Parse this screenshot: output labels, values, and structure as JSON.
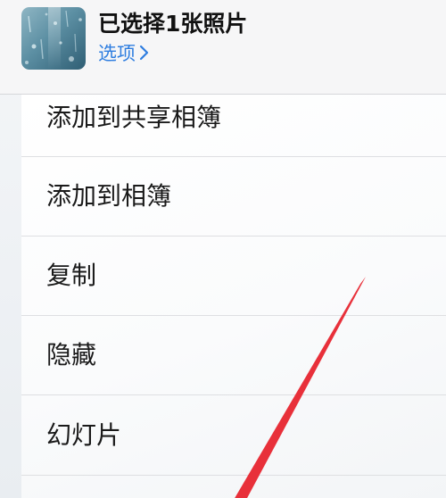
{
  "header": {
    "title": "已选择1张照片",
    "options_label": "选项",
    "options_chevron": "chevron-right-icon",
    "thumbnail": "rain-drops-photo-thumbnail"
  },
  "menu": {
    "items": [
      {
        "label": "添加到共享相簿"
      },
      {
        "label": "添加到相簿"
      },
      {
        "label": "复制"
      },
      {
        "label": "隐藏"
      },
      {
        "label": "幻灯片"
      }
    ]
  },
  "colors": {
    "link": "#2f7ee0",
    "annotation_arrow": "#e8303a",
    "separator": "#dedfe2"
  }
}
